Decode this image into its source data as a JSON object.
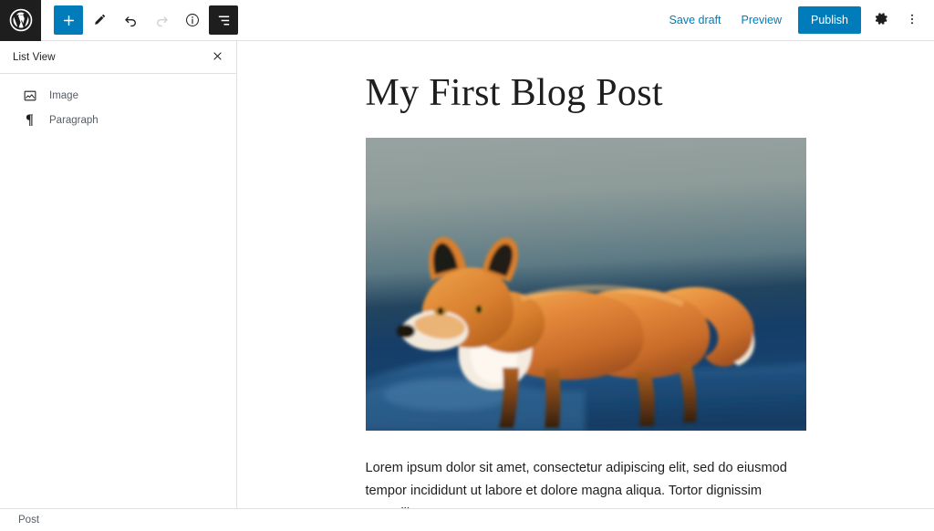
{
  "app": {
    "name": "WordPress Block Editor",
    "logo_icon": "wordpress-logo-icon"
  },
  "toolbar": {
    "left_tools": [
      {
        "name": "add-block-button",
        "icon": "plus-icon",
        "label": "Add block",
        "state": "primary"
      },
      {
        "name": "tools-button",
        "icon": "pencil-icon",
        "label": "Tools",
        "state": "default"
      },
      {
        "name": "undo-button",
        "icon": "undo-arrow-icon",
        "label": "Undo",
        "state": "default"
      },
      {
        "name": "redo-button",
        "icon": "redo-arrow-icon",
        "label": "Redo",
        "state": "disabled"
      },
      {
        "name": "details-button",
        "icon": "info-circle-icon",
        "label": "Details",
        "state": "default"
      },
      {
        "name": "list-view-button",
        "icon": "list-view-icon",
        "label": "List View",
        "state": "active"
      }
    ],
    "save_draft_label": "Save draft",
    "preview_label": "Preview",
    "publish_label": "Publish",
    "settings_icon": "gear-icon",
    "settings_label": "Settings",
    "options_icon": "ellipsis-vertical-icon",
    "options_label": "Options"
  },
  "sidebar": {
    "title": "List View",
    "close_icon": "close-icon",
    "close_label": "Close",
    "blocks": [
      {
        "label": "Image",
        "icon": "image-block-icon"
      },
      {
        "label": "Paragraph",
        "icon": "paragraph-block-icon"
      }
    ]
  },
  "post": {
    "title": "My First Blog Post",
    "image": {
      "alt": "Red fox standing on snow at sunset",
      "sky_top_color": "#8d9b99",
      "sky_bottom_color": "#15406b",
      "fur_color": "#e08a3c",
      "snow_shadow_color": "#1f4f7d"
    },
    "paragraph": "Lorem ipsum dolor sit amet, consectetur adipiscing elit, sed do eiusmod tempor incididunt ut labore et dolore magna aliqua. Tortor dignissim convallis aenean et tortor."
  },
  "statusbar": {
    "breadcrumb": "Post"
  },
  "colors": {
    "accent": "#007cba",
    "toolbar_active": "#1e1e1e",
    "border": "#e0e0e0",
    "text": "#1e1e1e",
    "muted_text": "#555d66"
  }
}
